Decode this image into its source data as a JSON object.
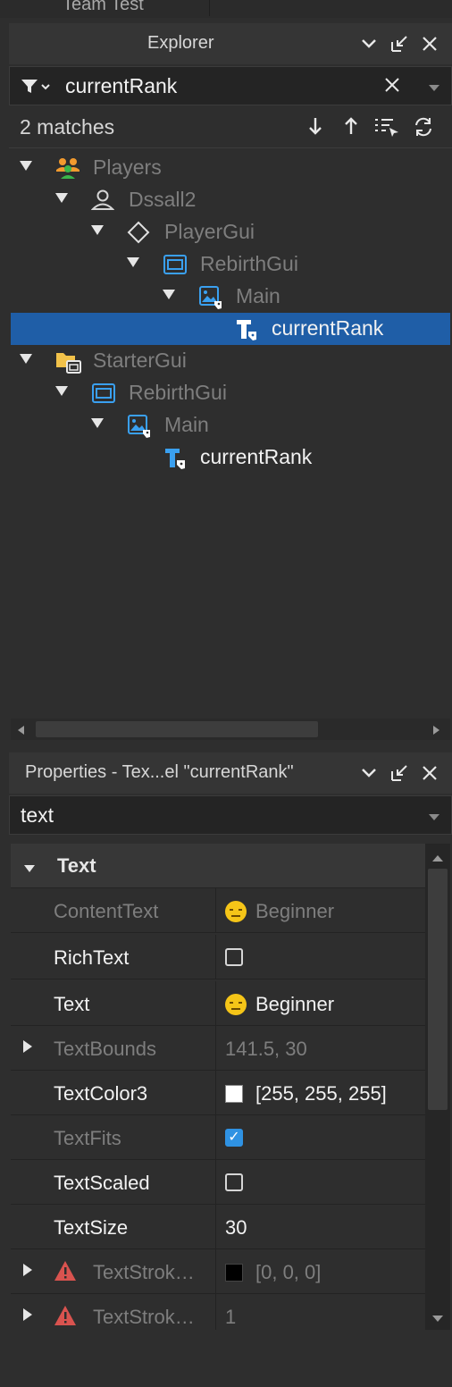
{
  "top_tab": {
    "label": "Team Test"
  },
  "explorer": {
    "title": "Explorer",
    "filter_value": "currentRank",
    "matches_text": "2 matches",
    "tree": [
      {
        "label": "Players",
        "icon": "players-icon",
        "depth": 0,
        "expanded": true,
        "dim": true,
        "selected": false
      },
      {
        "label": "Dssall2",
        "icon": "player-icon",
        "depth": 1,
        "expanded": true,
        "dim": true,
        "selected": false
      },
      {
        "label": "PlayerGui",
        "icon": "playergui-icon",
        "depth": 2,
        "expanded": true,
        "dim": true,
        "selected": false
      },
      {
        "label": "RebirthGui",
        "icon": "screengui-icon",
        "depth": 3,
        "expanded": true,
        "dim": true,
        "selected": false
      },
      {
        "label": "Main",
        "icon": "imagelabel-icon",
        "depth": 4,
        "expanded": true,
        "dim": true,
        "selected": false
      },
      {
        "label": "currentRank",
        "icon": "textlabel-icon",
        "depth": 5,
        "expanded": false,
        "dim": false,
        "selected": true
      },
      {
        "label": "StarterGui",
        "icon": "startergui-icon",
        "depth": 0,
        "expanded": true,
        "dim": true,
        "selected": false
      },
      {
        "label": "RebirthGui",
        "icon": "screengui-icon",
        "depth": 1,
        "expanded": true,
        "dim": true,
        "selected": false
      },
      {
        "label": "Main",
        "icon": "imagelabel-icon",
        "depth": 2,
        "expanded": true,
        "dim": true,
        "selected": false
      },
      {
        "label": "currentRank",
        "icon": "textlabel-icon",
        "depth": 3,
        "expanded": false,
        "dim": false,
        "selected": false
      }
    ]
  },
  "properties": {
    "title": "Properties - Tex...el \"currentRank\"",
    "filter_value": "text",
    "section": "Text",
    "rows": [
      {
        "name": "ContentText",
        "value": "Beginner",
        "kind": "emoji-text",
        "dim": true
      },
      {
        "name": "RichText",
        "value": "",
        "kind": "checkbox",
        "checked": false,
        "dim": false
      },
      {
        "name": "Text",
        "value": "Beginner",
        "kind": "emoji-text",
        "dim": false
      },
      {
        "name": "TextBounds",
        "value": "141.5, 30",
        "kind": "text",
        "dim": true,
        "expandable": true
      },
      {
        "name": "TextColor3",
        "value": "[255, 255, 255]",
        "kind": "color",
        "color": "#ffffff",
        "dim": false
      },
      {
        "name": "TextFits",
        "value": "",
        "kind": "checkbox",
        "checked": true,
        "dim": true
      },
      {
        "name": "TextScaled",
        "value": "",
        "kind": "checkbox",
        "checked": false,
        "dim": false
      },
      {
        "name": "TextSize",
        "value": "30",
        "kind": "text",
        "dim": false
      },
      {
        "name": "TextStrok…",
        "value": "[0, 0, 0]",
        "kind": "color",
        "color": "#000000",
        "dim": true,
        "expandable": true,
        "warning": true
      },
      {
        "name": "TextStrok…",
        "value": "1",
        "kind": "text",
        "dim": true,
        "expandable": true,
        "warning": true
      }
    ]
  },
  "colors": {
    "selection": "#1f5ea7",
    "checkbox_checked": "#2f92e3"
  }
}
